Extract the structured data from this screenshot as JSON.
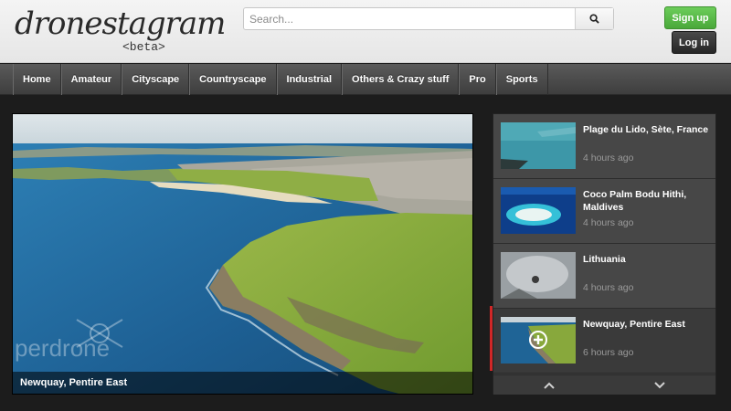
{
  "header": {
    "logo_text": "dronestagram",
    "logo_sub": "<beta>",
    "search_placeholder": "Search...",
    "signup_label": "Sign up",
    "login_label": "Log in"
  },
  "nav": {
    "items": [
      "Home",
      "Amateur",
      "Cityscape",
      "Countryscape",
      "Industrial",
      "Others & Crazy stuff",
      "Pro",
      "Sports"
    ]
  },
  "hero": {
    "caption": "Newquay, Pentire East",
    "watermark": "perdrone"
  },
  "sidebar": {
    "items": [
      {
        "title": "Plage du Lido, Sète, France",
        "time": "4 hours ago"
      },
      {
        "title": "Coco Palm Bodu Hithi, Maldives",
        "time": "4 hours ago"
      },
      {
        "title": "Lithuania",
        "time": "4 hours ago"
      },
      {
        "title": "Newquay, Pentire East",
        "time": "6 hours ago"
      }
    ]
  },
  "colors": {
    "signup_green": "#56b545",
    "active_red": "#d12727"
  }
}
